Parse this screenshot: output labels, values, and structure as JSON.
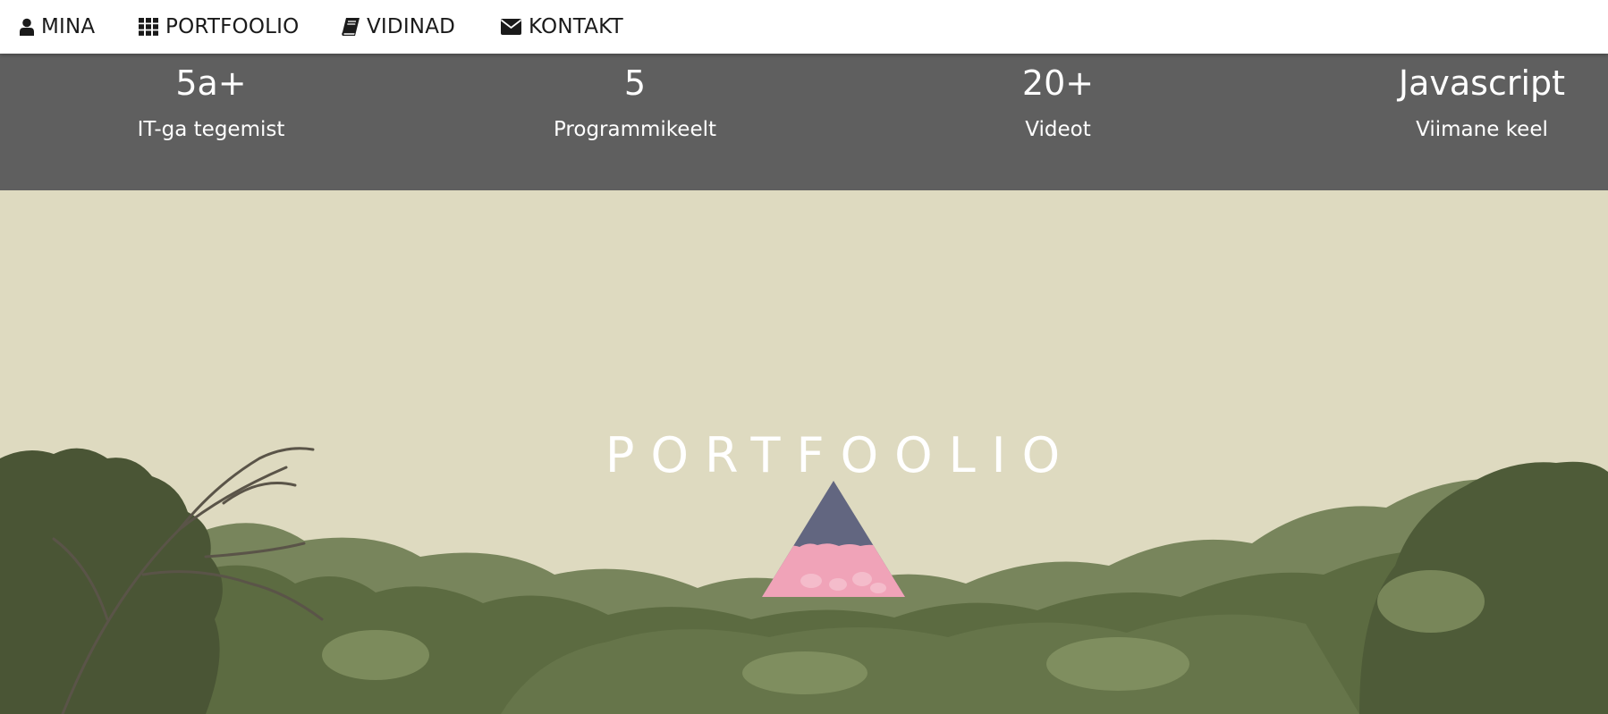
{
  "nav": {
    "items": [
      {
        "label": "MINA",
        "icon": "user-icon"
      },
      {
        "label": "PORTFOOLIO",
        "icon": "grid-icon"
      },
      {
        "label": "VIDINAD",
        "icon": "book-icon"
      },
      {
        "label": "KONTAKT",
        "icon": "envelope-icon"
      }
    ]
  },
  "stats": [
    {
      "value": "5a+",
      "label": "IT-ga tegemist"
    },
    {
      "value": "5",
      "label": "Programmikeelt"
    },
    {
      "value": "20+",
      "label": "Videot"
    },
    {
      "value": "Javascript",
      "label": "Viimane keel"
    }
  ],
  "hero": {
    "title": "PORTFOOLIO",
    "logo": "triangle-logo"
  },
  "colors": {
    "nav_bg": "#ffffff",
    "stats_bg": "#5f5f5f",
    "hero_bg": "#dedac0",
    "logo_top": "#626680",
    "logo_bottom": "#f0a3b8"
  }
}
